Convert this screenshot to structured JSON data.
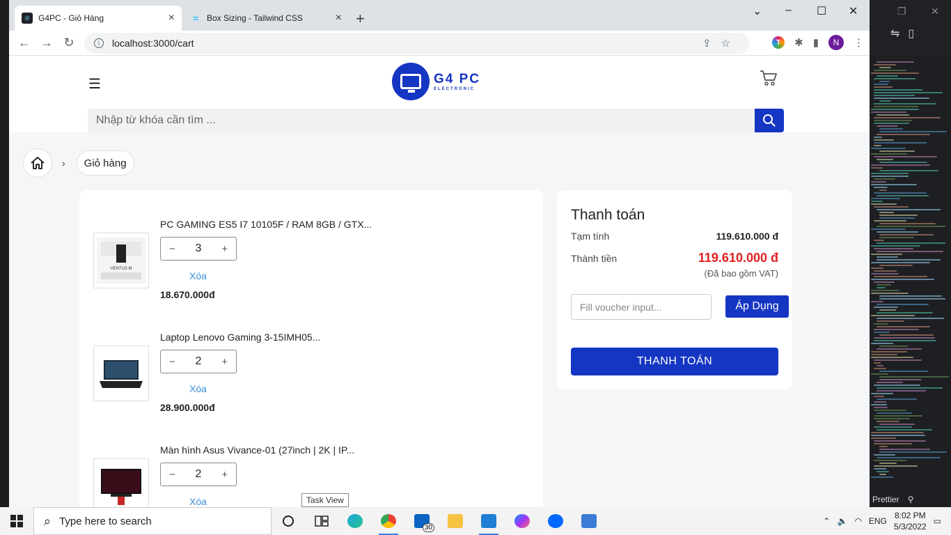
{
  "browser": {
    "tabs": [
      {
        "title": "G4PC - Giỏ Hàng",
        "active": true
      },
      {
        "title": "Box Sizing - Tailwind CSS",
        "active": false
      }
    ],
    "url": "localhost:3000/cart",
    "profile_initial": "N",
    "extension_initial": "T"
  },
  "header": {
    "logo_name": "G4 PC",
    "logo_sub": "ELECTRONIC",
    "search_placeholder": "Nhập từ khóa cần tìm ..."
  },
  "breadcrumb": {
    "separator": "›",
    "current": "Giỏ hàng"
  },
  "cart": {
    "items": [
      {
        "name": "PC GAMING ES5 I7 10105F / RAM 8GB / GTX...",
        "quantity": "3",
        "remove_label": "Xóa",
        "price": "18.670.000đ"
      },
      {
        "name": "Laptop Lenovo Gaming 3-15IMH05...",
        "quantity": "2",
        "remove_label": "Xóa",
        "price": "28.900.000đ"
      },
      {
        "name": "Màn hình Asus Vivance-01 (27inch | 2K | IP...",
        "quantity": "2",
        "remove_label": "Xóa",
        "price": ""
      }
    ],
    "minus": "−",
    "plus": "+"
  },
  "payment": {
    "title": "Thanh toán",
    "subtotal_label": "Tạm tính",
    "subtotal_value": "119.610.000 đ",
    "total_label": "Thành tiền",
    "total_value": "119.610.000 đ",
    "vat_note": "(Đã bao gồm VAT)",
    "voucher_placeholder": "Fill voucher input...",
    "apply_label": "Áp Dụng",
    "checkout_label": "THANH TOÁN"
  },
  "tooltip": "Task View",
  "taskbar": {
    "search_placeholder": "Type here to search",
    "mail_badge": "30",
    "language": "ENG",
    "time": "8:02 PM",
    "date": "5/3/2022"
  },
  "editor": {
    "status_prettier": "Prettier"
  },
  "colors": {
    "brand": "#1535c3",
    "price_red": "#e02020",
    "link": "#3b8fd9"
  }
}
